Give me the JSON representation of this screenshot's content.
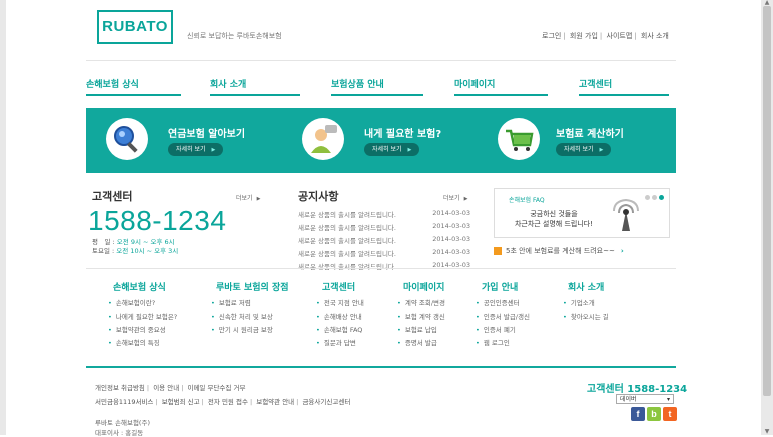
{
  "header": {
    "logo": "RUBATO",
    "tagline": "신뢰로 보답하는 루바토손해보험",
    "top_links": [
      "로그인",
      "회원 가입",
      "사이트맵",
      "회사 소개"
    ]
  },
  "gnb": [
    "손해보험 상식",
    "회사 소개",
    "보험상품 안내",
    "마이페이지",
    "고객센터"
  ],
  "banner": {
    "items": [
      {
        "title": "연금보험 알아보기",
        "button": "자세히 보기"
      },
      {
        "title": "내게 필요한 보험?",
        "button": "자세히 보기"
      },
      {
        "title": "보험료 계산하기",
        "button": "자세히 보기"
      }
    ]
  },
  "customer_center": {
    "title": "고객센터",
    "more": "더보기",
    "phone": "1588-1234",
    "weekday_label": "평　일 :",
    "weekday_hours": "오전 9시 ~ 오후 6시",
    "saturday_label": "토요일 :",
    "saturday_hours": "오전 10시 ~ 오후 3시"
  },
  "notice": {
    "title": "공지사항",
    "more": "더보기",
    "items": [
      {
        "text": "새로운 상품의 출시를 알려드립니다.",
        "date": "2014-03-03"
      },
      {
        "text": "새로운 상품의 출시를 알려드립니다.",
        "date": "2014-03-03"
      },
      {
        "text": "새로운 상품의 출시를 알려드립니다.",
        "date": "2014-03-03"
      },
      {
        "text": "새로운 상품의 출시를 알려드립니다.",
        "date": "2014-03-03"
      },
      {
        "text": "새로운 상품의 출시를 알려드립니다.",
        "date": "2014-03-03"
      }
    ]
  },
  "faq": {
    "label": "손해보험 FAQ",
    "line1": "궁금하신 것들을",
    "line2": "차근차근 설명해 드립니다!",
    "calc_link": "5초 안에 보험료를 계산해 드려요~~"
  },
  "sitemap": [
    {
      "title": "손해보험 상식",
      "items": [
        "손해보험이란?",
        "나에게 필요한 보험은?",
        "보험약관의 중요성",
        "손해보험의 특징"
      ]
    },
    {
      "title": "루바토 보험의 장점",
      "items": [
        "보험료 저렴",
        "신속한 처리 및 보상",
        "만기 시 원리금 보장"
      ]
    },
    {
      "title": "고객센터",
      "items": [
        "전국 지점 안내",
        "손해배상 안내",
        "손해보험 FAQ",
        "질문과 답변"
      ]
    },
    {
      "title": "마이페이지",
      "items": [
        "계약 조회/변경",
        "보험 계약 갱신",
        "보험료 납입",
        "증명서 발급"
      ]
    },
    {
      "title": "가입 안내",
      "items": [
        "공인인증센터",
        "인증서 발급/갱신",
        "인증서 폐기",
        "웹 로그인"
      ]
    },
    {
      "title": "회사 소개",
      "items": [
        "기업소개",
        "찾아오시는 길"
      ]
    }
  ],
  "footer": {
    "links1": [
      "개인정보 취급방침",
      "이용 안내",
      "이메일 무단수집 거부"
    ],
    "links2": [
      "서민금융1119서비스",
      "보험범죄 신고",
      "전자 민원 접수",
      "보험약관 안내",
      "금융사기신고센터"
    ],
    "company": "루바토 손해보험(주)",
    "ceo": "대표이사 : 홍길동",
    "cs": "고객센터 1588-1234",
    "select_value": "데이버",
    "sns": [
      "f",
      "b",
      "t"
    ]
  },
  "colors": {
    "accent": "#0aa59a",
    "banner": "#11a89d",
    "facebook": "#3b5998",
    "blog": "#8cc63f",
    "twitter": "#f26522"
  }
}
